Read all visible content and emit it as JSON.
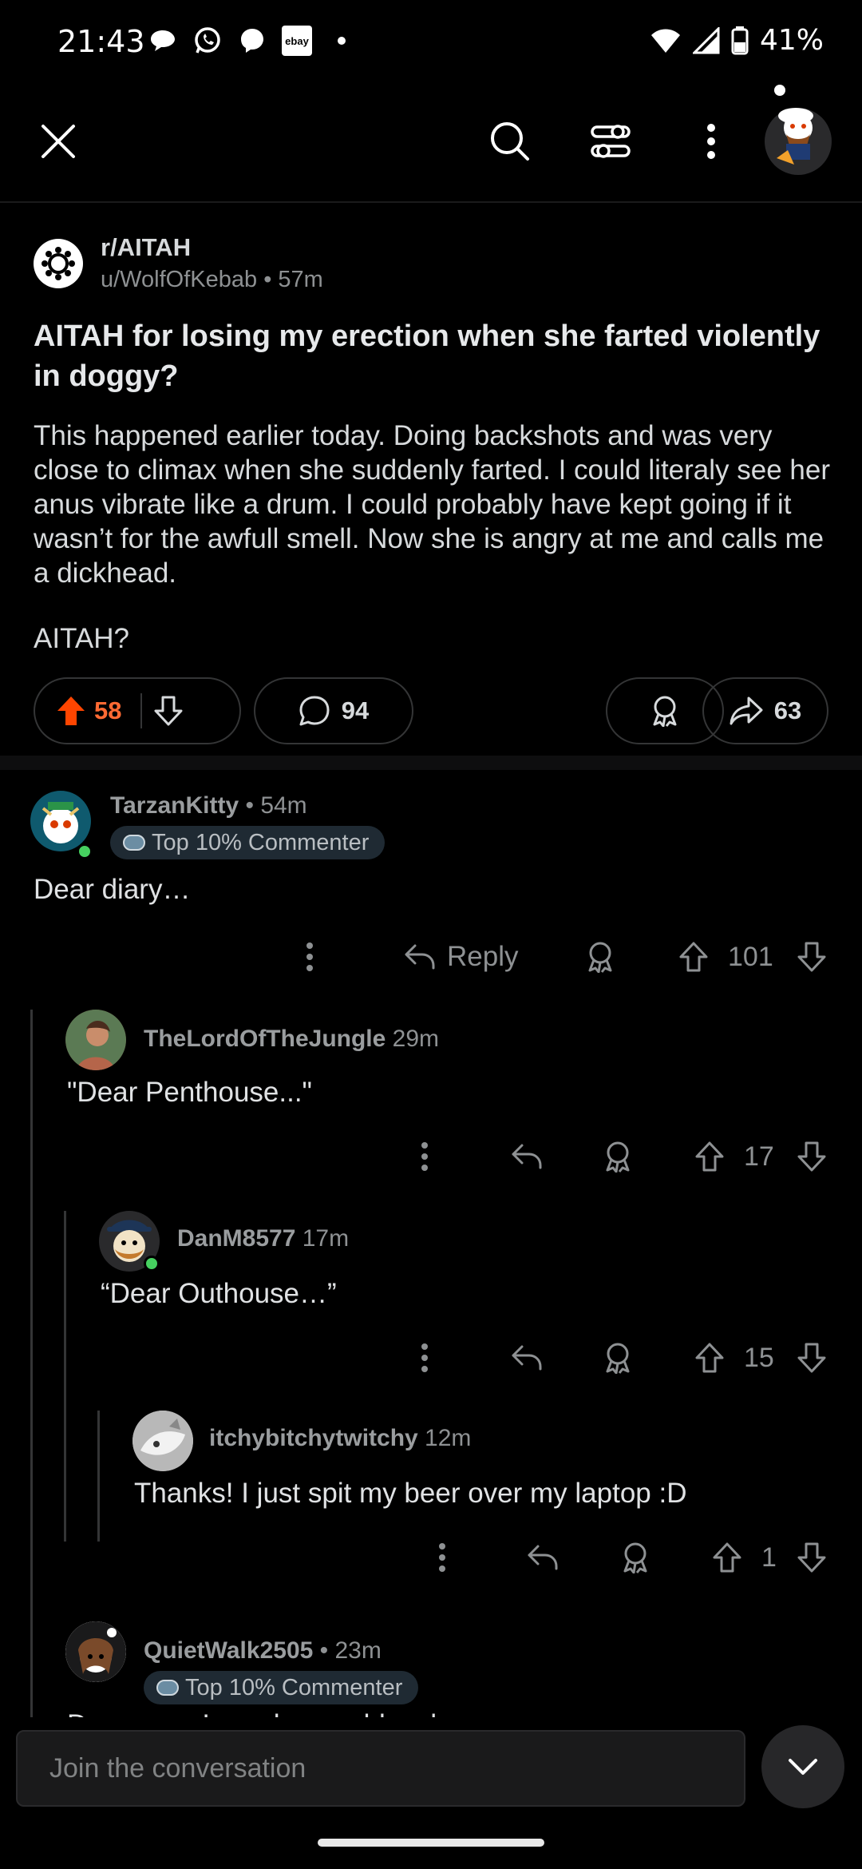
{
  "status_bar": {
    "time": "21:43",
    "notification_icons": [
      "chat-bubble-icon",
      "whatsapp-icon",
      "messenger-icon",
      "ebay-icon",
      "dot-icon"
    ],
    "ebay_label": "ebay",
    "battery": "41%"
  },
  "toolbar": {
    "avatar_icon": "snoo-avatar-icon"
  },
  "post": {
    "subreddit": "r/AITAH",
    "author_line": "u/WolfOfKebab • 57m",
    "title": "AITAH for losing my erection when she farted violently in doggy?",
    "body": "This happened earlier today. Doing backshots and was very close to climax when she suddenly farted. I could literaly see her anus vibrate like a drum. I could probably have kept going if it wasn’t for the awfull smell. Now she is angry at me and calls me a dickhead.",
    "closing": "AITAH?",
    "upvotes": "58",
    "comments": "94",
    "shares": "63",
    "upvoted": true
  },
  "comments": [
    {
      "user": "TarzanKitty",
      "time": " • 54m",
      "flair": "Top 10% Commenter",
      "text": "Dear diary…",
      "reply_label": "Reply",
      "votes": "101"
    },
    {
      "user": "TheLordOfTheJungle",
      "time": " 29m",
      "text": "\"Dear Penthouse...\"",
      "votes": "17"
    },
    {
      "user": "DanM8577",
      "time": " 17m",
      "text": "“Dear Outhouse…”",
      "votes": "15"
    },
    {
      "user": "itchybitchytwitchy",
      "time": " 12m",
      "text": "Thanks! I just spit my beer over my laptop :D",
      "votes": "1"
    },
    {
      "user": "QuietWalk2505",
      "time": " • 23m",
      "flair": "Top 10% Commenter",
      "text": "Dear eyes I need some bleach"
    }
  ],
  "bottom": {
    "placeholder": "Join the conversation"
  },
  "colors": {
    "upvote": "#ff6a33",
    "online": "#46d160",
    "background": "#000000"
  }
}
